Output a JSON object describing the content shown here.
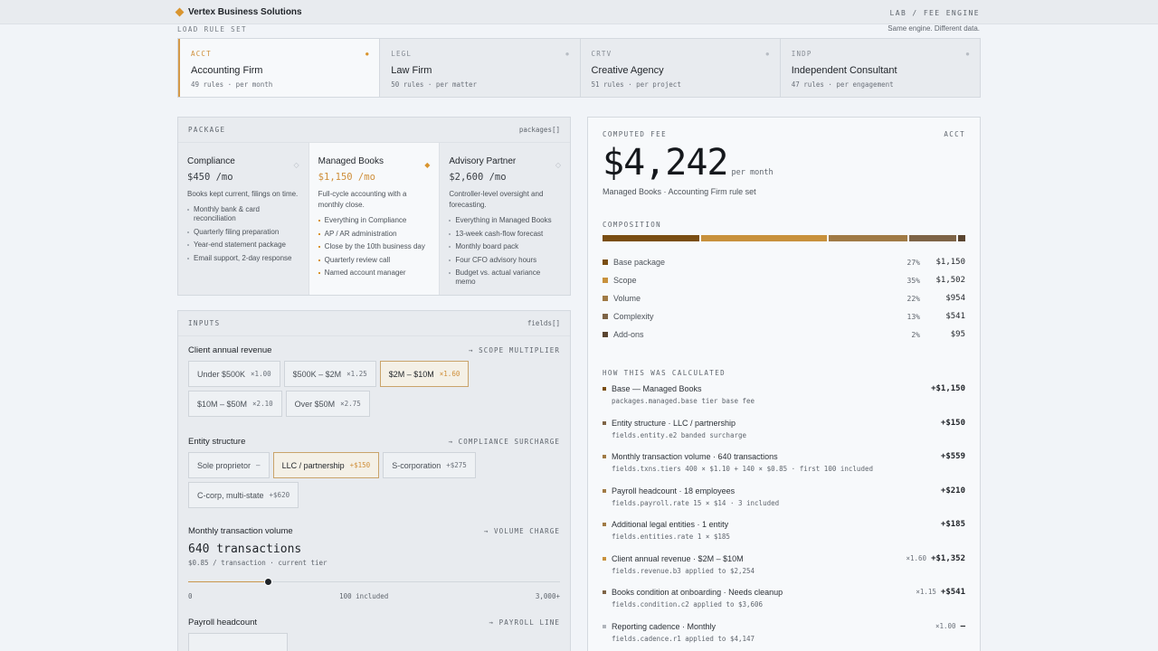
{
  "brand": {
    "name": "Vertex Business Solutions"
  },
  "header": {
    "crumb": "LAB / FEE ENGINE"
  },
  "rule_sets": {
    "label": "LOAD RULE SET",
    "tagline": "Same engine. Different data.",
    "items": [
      {
        "code": "ACCT",
        "name": "Accounting Firm",
        "meta": "49 rules · per month"
      },
      {
        "code": "LEGL",
        "name": "Law Firm",
        "meta": "50 rules · per matter"
      },
      {
        "code": "CRTV",
        "name": "Creative Agency",
        "meta": "51 rules · per project"
      },
      {
        "code": "INDP",
        "name": "Independent Consultant",
        "meta": "47 rules · per engagement"
      }
    ]
  },
  "package": {
    "title": "PACKAGE",
    "tag": "packages[]",
    "items": [
      {
        "name": "Compliance",
        "price": "$450 /mo",
        "desc": "Books kept current, filings on time.",
        "features": [
          "Monthly bank & card reconciliation",
          "Quarterly filing preparation",
          "Year-end statement package",
          "Email support, 2-day response"
        ]
      },
      {
        "name": "Managed Books",
        "price": "$1,150 /mo",
        "desc": "Full-cycle accounting with a monthly close.",
        "features": [
          "Everything in Compliance",
          "AP / AR administration",
          "Close by the 10th business day",
          "Quarterly review call",
          "Named account manager"
        ]
      },
      {
        "name": "Advisory Partner",
        "price": "$2,600 /mo",
        "desc": "Controller-level oversight and forecasting.",
        "features": [
          "Everything in Managed Books",
          "13-week cash-flow forecast",
          "Monthly board pack",
          "Four CFO advisory hours",
          "Budget vs. actual variance memo"
        ]
      }
    ]
  },
  "inputs": {
    "title": "INPUTS",
    "tag": "fields[]",
    "revenue": {
      "label": "Client annual revenue",
      "hint": "→ SCOPE MULTIPLIER",
      "options": [
        {
          "label": "Under $500K",
          "mul": "×1.00"
        },
        {
          "label": "$500K – $2M",
          "mul": "×1.25"
        },
        {
          "label": "$2M – $10M",
          "mul": "×1.60"
        },
        {
          "label": "$10M – $50M",
          "mul": "×2.10"
        },
        {
          "label": "Over $50M",
          "mul": "×2.75"
        }
      ]
    },
    "entity": {
      "label": "Entity structure",
      "hint": "→ COMPLIANCE SURCHARGE",
      "options": [
        {
          "label": "Sole proprietor",
          "mul": "—"
        },
        {
          "label": "LLC / partnership",
          "mul": "+$150"
        },
        {
          "label": "S-corporation",
          "mul": "+$275"
        },
        {
          "label": "C-corp, multi-state",
          "mul": "+$620"
        }
      ]
    },
    "volume": {
      "label": "Monthly transaction volume",
      "hint": "→ VOLUME CHARGE",
      "value": "640 transactions",
      "sub": "$0.85 / transaction · current tier",
      "fraction": 0.2133,
      "ticks": [
        "0",
        "100 included",
        "3,000+"
      ]
    },
    "payroll": {
      "label": "Payroll headcount",
      "hint": "→ PAYROLL LINE"
    }
  },
  "fee": {
    "label": "COMPUTED FEE",
    "code": "ACCT",
    "amount": "$4,242",
    "unit": "per month",
    "sub": "Managed Books · Accounting Firm rule set",
    "composition_label": "COMPOSITION",
    "composition": [
      {
        "name": "Base package",
        "pct": "27%",
        "value": "$1,150",
        "color": "#7a4e13",
        "share": 27
      },
      {
        "name": "Scope",
        "pct": "35%",
        "value": "$1,502",
        "color": "#c8913c",
        "share": 35
      },
      {
        "name": "Volume",
        "pct": "22%",
        "value": "$954",
        "color": "#a07a45",
        "share": 22
      },
      {
        "name": "Complexity",
        "pct": "13%",
        "value": "$541",
        "color": "#7e6446",
        "share": 13
      },
      {
        "name": "Add-ons",
        "pct": "2%",
        "value": "$95",
        "color": "#5a4530",
        "share": 2
      }
    ],
    "calc_label": "HOW THIS WAS CALCULATED",
    "steps": [
      {
        "name": "Base — Managed Books",
        "code": "packages.managed.base   tier base fee",
        "mul": "",
        "value": "+$1,150",
        "color": "#7a4e13"
      },
      {
        "name": "Entity structure · LLC / partnership",
        "code": "fields.entity.e2   banded surcharge",
        "mul": "",
        "value": "+$150",
        "color": "#7e6446"
      },
      {
        "name": "Monthly transaction volume · 640 transactions",
        "code": "fields.txns.tiers   400 × $1.10 + 140 × $0.85 · first 100 included",
        "mul": "",
        "value": "+$559",
        "color": "#a07a45"
      },
      {
        "name": "Payroll headcount · 18 employees",
        "code": "fields.payroll.rate   15 × $14 · 3 included",
        "mul": "",
        "value": "+$210",
        "color": "#a07a45"
      },
      {
        "name": "Additional legal entities · 1 entity",
        "code": "fields.entities.rate   1 × $185",
        "mul": "",
        "value": "+$185",
        "color": "#a07a45"
      },
      {
        "name": "Client annual revenue · $2M – $10M",
        "code": "fields.revenue.b3   applied to $2,254",
        "mul": "×1.60",
        "value": "+$1,352",
        "color": "#c8913c"
      },
      {
        "name": "Books condition at onboarding · Needs cleanup",
        "code": "fields.condition.c2   applied to $3,606",
        "mul": "×1.15",
        "value": "+$541",
        "color": "#7e6446"
      },
      {
        "name": "Reporting cadence · Monthly",
        "code": "fields.cadence.r1   applied to $4,147",
        "mul": "×1.00",
        "value": "—",
        "color": "#b0b5bb"
      }
    ]
  }
}
